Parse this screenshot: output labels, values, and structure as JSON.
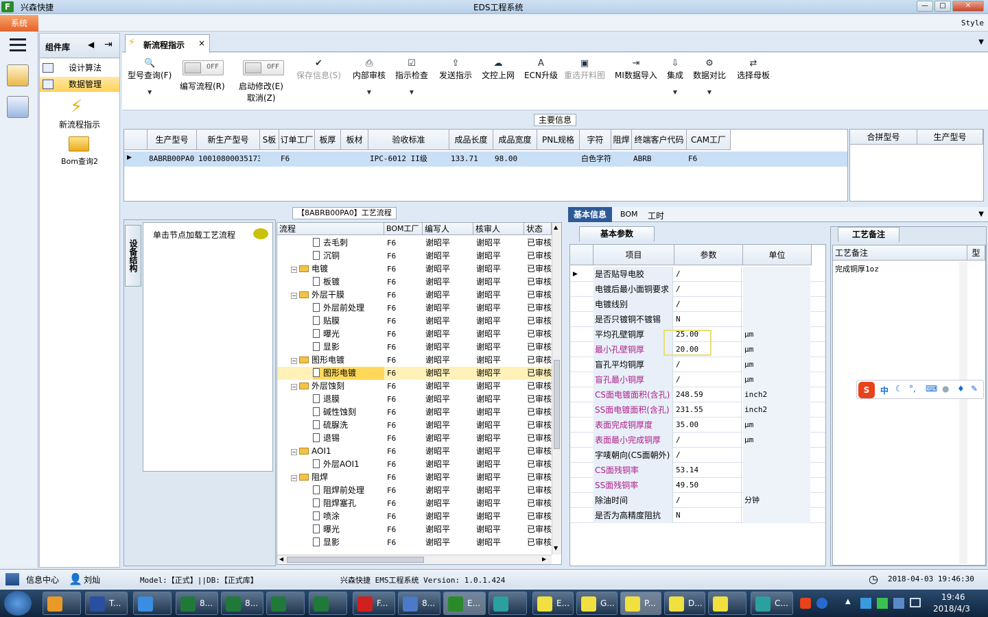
{
  "window": {
    "app_name": "兴森快捷",
    "title": "EDS工程系统",
    "minimize": "—",
    "maximize": "□",
    "close": "✕"
  },
  "menu": {
    "system": "系统",
    "style": "Style"
  },
  "components": {
    "header": "组件库",
    "items": [
      {
        "label": "设计算法"
      },
      {
        "label": "数据管理"
      }
    ],
    "big_items": [
      {
        "label": "新流程指示"
      },
      {
        "label": "Bom查询2"
      }
    ]
  },
  "tab": {
    "label": "新流程指示",
    "close": "×"
  },
  "toolbar": {
    "buttons": [
      {
        "label": "型号查询(F)",
        "icon": "search-icon"
      },
      {
        "label": "编写流程(R)",
        "toggle": "OFF"
      },
      {
        "label": "启动修改(E)",
        "label2": "取消(Z)",
        "toggle": "OFF"
      },
      {
        "label": "保存信息(S)",
        "icon": "check-icon"
      },
      {
        "label": "内部审核",
        "icon": "printer-icon"
      },
      {
        "label": "指示检查",
        "icon": "checkbox-icon"
      },
      {
        "label": "发送指示",
        "icon": "upload-icon"
      },
      {
        "label": "文控上网",
        "icon": "cloud-upload-icon"
      },
      {
        "label": "ECN升级",
        "icon": "font-icon"
      },
      {
        "label": "重选开料图",
        "icon": "image-icon"
      },
      {
        "label": "MI数据导入",
        "icon": "import-icon"
      },
      {
        "label": "集成",
        "icon": "download-icon"
      },
      {
        "label": "数据对比",
        "icon": "compare-icon"
      },
      {
        "label": "选择母板",
        "icon": "shuffle-icon"
      }
    ]
  },
  "main_info": {
    "title": "主要信息",
    "columns": [
      "生产型号",
      "新生产型号",
      "S板",
      "订单工厂",
      "板厚",
      "板材",
      "验收标准",
      "成品长度",
      "成品宽度",
      "PNL规格",
      "字符",
      "阻焊",
      "终端客户代码",
      "CAM工厂"
    ],
    "row": [
      "8ABRB00PA0",
      "10010800035173",
      "",
      "F6",
      "",
      "",
      "IPC-6012 II级",
      "133.71",
      "98.00",
      "",
      "白色字符",
      "",
      "ABRB",
      "F6"
    ],
    "side_columns": [
      "合拼型号",
      "生产型号"
    ]
  },
  "flow": {
    "title": "【8ABRB00PA0】工艺流程",
    "vtab": "设备结构",
    "load_hint": "单击节点加载工艺流程",
    "columns": [
      "流程",
      "BOM工厂",
      "编写人",
      "核审人",
      "状态"
    ],
    "rows": [
      {
        "level": 2,
        "name": "去毛刺",
        "bom": "F6",
        "writer": "谢昭平",
        "reviewer": "谢昭平",
        "status": "已审核"
      },
      {
        "level": 2,
        "name": "沉铜",
        "bom": "F6",
        "writer": "谢昭平",
        "reviewer": "谢昭平",
        "status": "已审核"
      },
      {
        "level": 1,
        "name": "电镀",
        "bom": "F6",
        "writer": "谢昭平",
        "reviewer": "谢昭平",
        "status": "已审核"
      },
      {
        "level": 2,
        "name": "板镀",
        "bom": "F6",
        "writer": "谢昭平",
        "reviewer": "谢昭平",
        "status": "已审核"
      },
      {
        "level": 1,
        "name": "外层干膜",
        "bom": "F6",
        "writer": "谢昭平",
        "reviewer": "谢昭平",
        "status": "已审核"
      },
      {
        "level": 2,
        "name": "外层前处理",
        "bom": "F6",
        "writer": "谢昭平",
        "reviewer": "谢昭平",
        "status": "已审核"
      },
      {
        "level": 2,
        "name": "贴膜",
        "bom": "F6",
        "writer": "谢昭平",
        "reviewer": "谢昭平",
        "status": "已审核"
      },
      {
        "level": 2,
        "name": "曝光",
        "bom": "F6",
        "writer": "谢昭平",
        "reviewer": "谢昭平",
        "status": "已审核"
      },
      {
        "level": 2,
        "name": "显影",
        "bom": "F6",
        "writer": "谢昭平",
        "reviewer": "谢昭平",
        "status": "已审核"
      },
      {
        "level": 1,
        "name": "图形电镀",
        "bom": "F6",
        "writer": "谢昭平",
        "reviewer": "谢昭平",
        "status": "已审核"
      },
      {
        "level": 2,
        "name": "图形电镀",
        "bom": "F6",
        "writer": "谢昭平",
        "reviewer": "谢昭平",
        "status": "已审核",
        "selected": true
      },
      {
        "level": 1,
        "name": "外层蚀刻",
        "bom": "F6",
        "writer": "谢昭平",
        "reviewer": "谢昭平",
        "status": "已审核"
      },
      {
        "level": 2,
        "name": "退膜",
        "bom": "F6",
        "writer": "谢昭平",
        "reviewer": "谢昭平",
        "status": "已审核"
      },
      {
        "level": 2,
        "name": "碱性蚀刻",
        "bom": "F6",
        "writer": "谢昭平",
        "reviewer": "谢昭平",
        "status": "已审核"
      },
      {
        "level": 2,
        "name": "硫脲洗",
        "bom": "F6",
        "writer": "谢昭平",
        "reviewer": "谢昭平",
        "status": "已审核"
      },
      {
        "level": 2,
        "name": "退锡",
        "bom": "F6",
        "writer": "谢昭平",
        "reviewer": "谢昭平",
        "status": "已审核"
      },
      {
        "level": 1,
        "name": "AOI1",
        "bom": "F6",
        "writer": "谢昭平",
        "reviewer": "谢昭平",
        "status": "已审核"
      },
      {
        "level": 2,
        "name": "外层AOI1",
        "bom": "F6",
        "writer": "谢昭平",
        "reviewer": "谢昭平",
        "status": "已审核"
      },
      {
        "level": 1,
        "name": "阻焊",
        "bom": "F6",
        "writer": "谢昭平",
        "reviewer": "谢昭平",
        "status": "已审核"
      },
      {
        "level": 2,
        "name": "阻焊前处理",
        "bom": "F6",
        "writer": "谢昭平",
        "reviewer": "谢昭平",
        "status": "已审核"
      },
      {
        "level": 2,
        "name": "阻焊塞孔",
        "bom": "F6",
        "writer": "谢昭平",
        "reviewer": "谢昭平",
        "status": "已审核"
      },
      {
        "level": 2,
        "name": "喷涂",
        "bom": "F6",
        "writer": "谢昭平",
        "reviewer": "谢昭平",
        "status": "已审核"
      },
      {
        "level": 2,
        "name": "曝光",
        "bom": "F6",
        "writer": "谢昭平",
        "reviewer": "谢昭平",
        "status": "已审核"
      },
      {
        "level": 2,
        "name": "显影",
        "bom": "F6",
        "writer": "谢昭平",
        "reviewer": "谢昭平",
        "status": "已审核"
      }
    ]
  },
  "detail_tabs": [
    "基本信息",
    "BOM",
    "工时"
  ],
  "params": {
    "subtab": "基本参数",
    "columns": [
      "项目",
      "参数",
      "单位"
    ],
    "rows": [
      {
        "item": "是否贴导电胶",
        "value": "/",
        "unit": "",
        "pink": false
      },
      {
        "item": "电镀后最小面铜要求",
        "value": "/",
        "unit": "",
        "pink": false
      },
      {
        "item": "电镀线别",
        "value": "/",
        "unit": "",
        "pink": false
      },
      {
        "item": "是否只镀铜不镀锡",
        "value": "N",
        "unit": "",
        "pink": false
      },
      {
        "item": "平均孔壁铜厚",
        "value": "25.00",
        "unit": "μm",
        "pink": false
      },
      {
        "item": "最小孔壁铜厚",
        "value": "20.00",
        "unit": "μm",
        "pink": true
      },
      {
        "item": "盲孔平均铜厚",
        "value": "/",
        "unit": "μm",
        "pink": false
      },
      {
        "item": "盲孔最小铜厚",
        "value": "/",
        "unit": "μm",
        "pink": true
      },
      {
        "item": "CS面电镀面积(含孔)",
        "value": "248.59",
        "unit": "inch2",
        "pink": true
      },
      {
        "item": "SS面电镀面积(含孔)",
        "value": "231.55",
        "unit": "inch2",
        "pink": true
      },
      {
        "item": "表面完成铜厚度",
        "value": "35.00",
        "unit": "μm",
        "pink": true
      },
      {
        "item": "表面最小完成铜厚",
        "value": "/",
        "unit": "μm",
        "pink": true
      },
      {
        "item": "字唛朝向(CS面朝外)",
        "value": "/",
        "unit": "",
        "pink": false
      },
      {
        "item": "CS面残铜率",
        "value": "53.14",
        "unit": "",
        "pink": true
      },
      {
        "item": "SS面残铜率",
        "value": "49.50",
        "unit": "",
        "pink": true
      },
      {
        "item": "除油时间",
        "value": "/",
        "unit": "分钟",
        "pink": false
      },
      {
        "item": "是否为高精度阻抗",
        "value": "N",
        "unit": "",
        "pink": false
      }
    ]
  },
  "remarks": {
    "tab": "工艺备注",
    "column": "工艺备注",
    "column2": "型",
    "text": "完成铜厚1oz"
  },
  "ime": {
    "lang": "中"
  },
  "status": {
    "info_center": "信息中心",
    "user": "刘灿",
    "model": "Model:【正式】||DB:【正式库】",
    "version": "兴森快捷 EMS工程系统 Version: 1.0.1.424",
    "datetime": "2018-04-03 19:46:30"
  },
  "taskbar": {
    "time": "19:46",
    "date": "2018/4/3",
    "buttons": [
      "T...",
      "8...",
      "8...",
      "F...",
      "8...",
      "E...",
      "E...",
      "G...",
      "P...",
      "D...",
      "C..."
    ]
  }
}
